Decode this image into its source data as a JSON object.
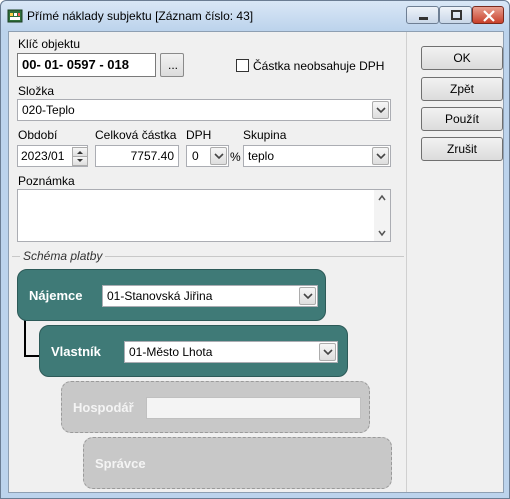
{
  "window": {
    "title": "Přímé náklady subjektu  [Záznam číslo: 43]"
  },
  "form": {
    "klic_label": "Klíč objektu",
    "klic_value": "00- 01- 0597 - 018",
    "browse_button": "...",
    "dph_checkbox_label": "Částka neobsahuje DPH",
    "dph_checkbox_checked": false,
    "slozka_label": "Složka",
    "slozka_value": "020-Teplo",
    "obdobi_label": "Období",
    "obdobi_value": "2023/01",
    "castka_label": "Celková částka",
    "castka_value": "7757.40",
    "dph_label": "DPH",
    "dph_value": "0",
    "percent_sign": "%",
    "skupina_label": "Skupina",
    "skupina_value": "teplo",
    "poznamka_label": "Poznámka",
    "poznamka_value": ""
  },
  "buttons": {
    "ok": "OK",
    "zpet": "Zpět",
    "pouzit": "Použít",
    "zrusit": "Zrušit"
  },
  "schema": {
    "title": "Schéma platby",
    "najemce_label": "Nájemce",
    "najemce_value": "01-Stanovská Jiřina",
    "vlastnik_label": "Vlastník",
    "vlastnik_value": "01-Město Lhota",
    "hospodar_label": "Hospodář",
    "hospodar_value": "",
    "spravce_label": "Správce"
  },
  "colors": {
    "active_box": "#3f7a77",
    "inactive_box": "#c8c8c8"
  },
  "icons": {
    "app": "app-icon",
    "minimize": "minimize-icon",
    "maximize": "maximize-icon",
    "close": "close-icon"
  }
}
